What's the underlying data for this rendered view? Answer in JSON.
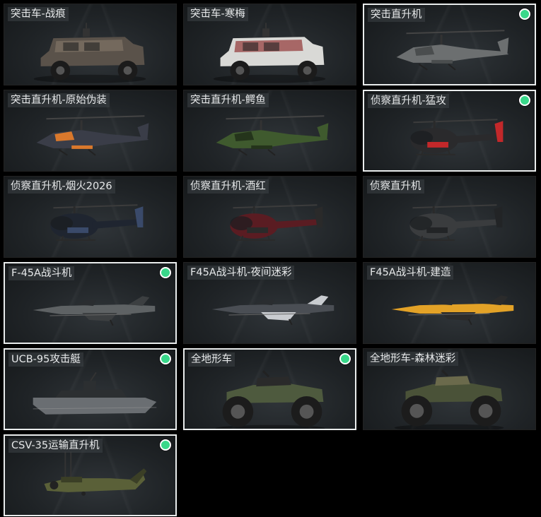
{
  "vehicles": [
    {
      "name": "突击车-战痕",
      "selected": false,
      "kind": "truck",
      "colors": {
        "main": "#5a524a",
        "accent": "#7a6f62"
      }
    },
    {
      "name": "突击车-寒梅",
      "selected": false,
      "kind": "truck",
      "colors": {
        "main": "#d9d9d6",
        "accent": "#9a4a4a"
      }
    },
    {
      "name": "突击直升机",
      "selected": true,
      "kind": "attack-heli",
      "colors": {
        "main": "#6c6f70",
        "accent": "#4a4d4e"
      }
    },
    {
      "name": "突击直升机-原始伪装",
      "selected": false,
      "kind": "attack-heli",
      "colors": {
        "main": "#3a3d48",
        "accent": "#d9782c"
      }
    },
    {
      "name": "突击直升机-鳄鱼",
      "selected": false,
      "kind": "attack-heli",
      "colors": {
        "main": "#3f5a2e",
        "accent": "#24341b"
      }
    },
    {
      "name": "侦察直升机-猛攻",
      "selected": true,
      "kind": "scout-heli",
      "colors": {
        "main": "#2a2a2c",
        "accent": "#c2282a"
      }
    },
    {
      "name": "侦察直升机-烟火2026",
      "selected": false,
      "kind": "scout-heli",
      "colors": {
        "main": "#1f2530",
        "accent": "#3a4a6a"
      }
    },
    {
      "name": "侦察直升机-酒红",
      "selected": false,
      "kind": "scout-heli",
      "colors": {
        "main": "#5a1c22",
        "accent": "#2a2a2a"
      }
    },
    {
      "name": "侦察直升机",
      "selected": false,
      "kind": "scout-heli",
      "colors": {
        "main": "#3a3c3e",
        "accent": "#222426"
      }
    },
    {
      "name": "F-45A战斗机",
      "selected": true,
      "kind": "jet",
      "colors": {
        "main": "#5e6264",
        "accent": "#3c3f41"
      }
    },
    {
      "name": "F45A战斗机-夜间迷彩",
      "selected": false,
      "kind": "jet",
      "colors": {
        "main": "#4a4e54",
        "accent": "#c9ccd0"
      }
    },
    {
      "name": "F45A战斗机-建造",
      "selected": false,
      "kind": "jet",
      "colors": {
        "main": "#e3a227",
        "accent": "#2b2b2b"
      }
    },
    {
      "name": "UCB-95攻击艇",
      "selected": true,
      "kind": "boat",
      "colors": {
        "main": "#6a6e72",
        "accent": "#2c2f31"
      }
    },
    {
      "name": "全地形车",
      "selected": true,
      "kind": "atv",
      "colors": {
        "main": "#4e5a3e",
        "accent": "#2a2a2a"
      }
    },
    {
      "name": "全地形车-森林迷彩",
      "selected": false,
      "kind": "atv",
      "colors": {
        "main": "#4a5238",
        "accent": "#6b6a4c"
      }
    },
    {
      "name": "CSV-35运输直升机",
      "selected": true,
      "kind": "tiltrotor",
      "colors": {
        "main": "#5a6038",
        "accent": "#3b3f26"
      }
    }
  ],
  "badge_color": "#39d88a"
}
